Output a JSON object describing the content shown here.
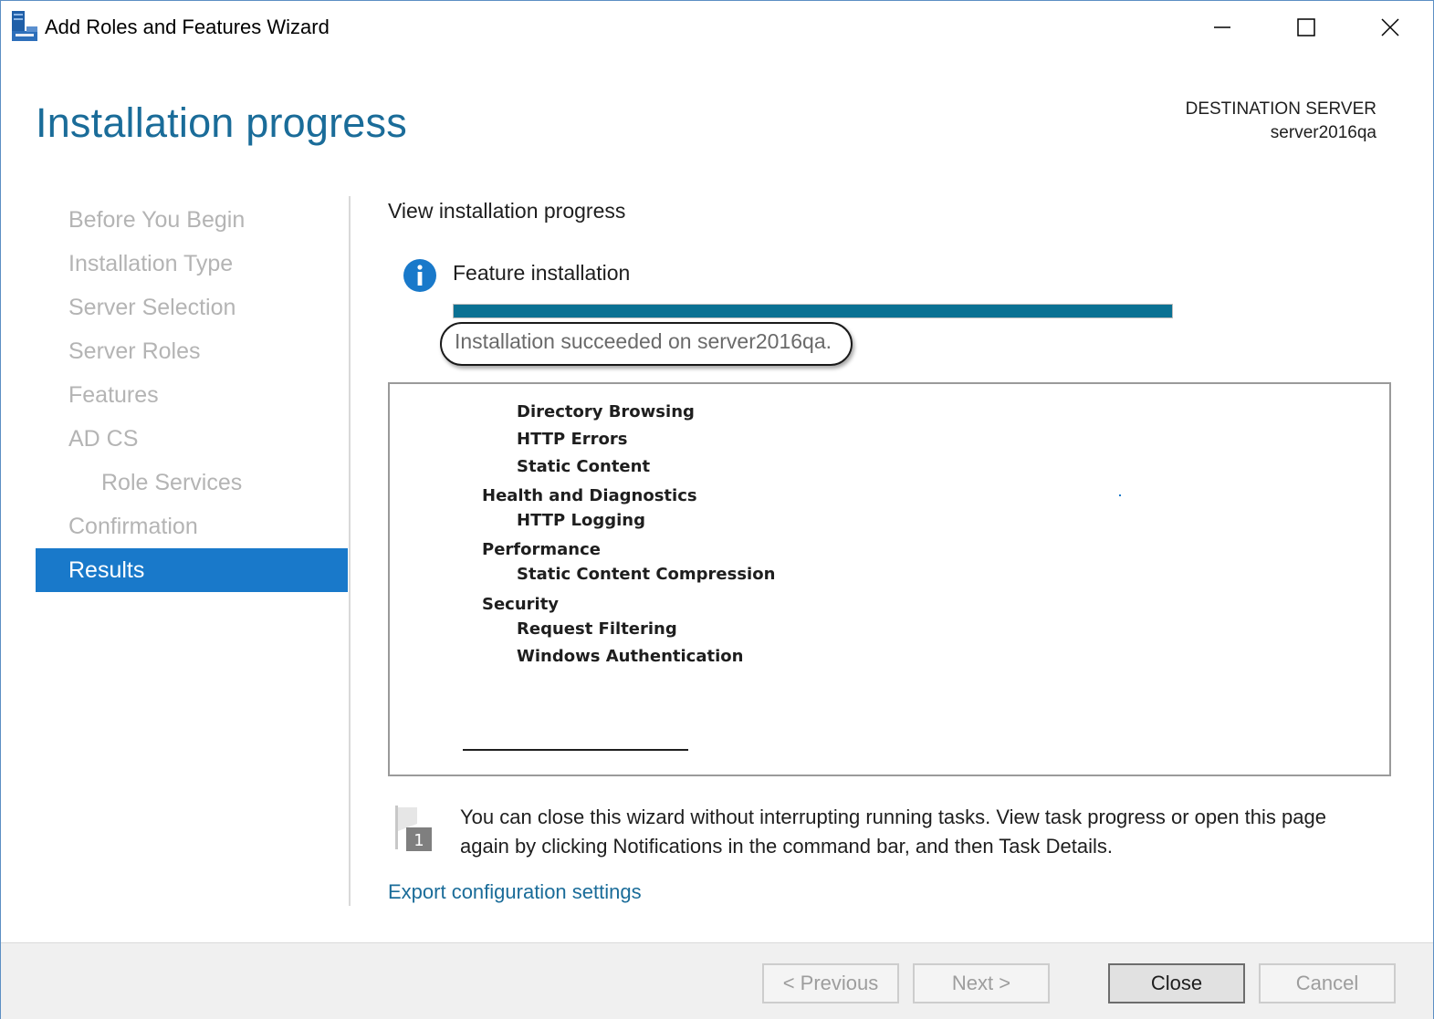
{
  "window": {
    "title": "Add Roles and Features Wizard"
  },
  "header": {
    "page_title": "Installation progress",
    "destination_label": "DESTINATION SERVER",
    "destination_server": "server2016qa"
  },
  "nav": {
    "items": [
      {
        "label": "Before You Begin"
      },
      {
        "label": "Installation Type"
      },
      {
        "label": "Server Selection"
      },
      {
        "label": "Server Roles"
      },
      {
        "label": "Features"
      },
      {
        "label": "AD CS"
      },
      {
        "label": "Role Services"
      },
      {
        "label": "Confirmation"
      },
      {
        "label": "Results"
      }
    ],
    "active": "Results"
  },
  "content": {
    "section_heading": "View installation progress",
    "feature_title": "Feature installation",
    "progress_fraction": 1.0,
    "status_text": "Installation succeeded on server2016qa.",
    "tree": [
      {
        "label": "Directory Browsing",
        "level": 2
      },
      {
        "label": "HTTP Errors",
        "level": 2
      },
      {
        "label": "Static Content",
        "level": 2
      },
      {
        "label": "Health and Diagnostics",
        "level": 1
      },
      {
        "label": "HTTP Logging",
        "level": 2
      },
      {
        "label": "Performance",
        "level": 1
      },
      {
        "label": "Static Content Compression",
        "level": 2
      },
      {
        "label": "Security",
        "level": 1
      },
      {
        "label": "Request Filtering",
        "level": 2
      },
      {
        "label": "Windows Authentication",
        "level": 2
      }
    ],
    "note_text": "You can close this wizard without interrupting running tasks. View task progress or open this page again by clicking Notifications in the command bar, and then Task Details.",
    "flag_badge": "1",
    "export_link": "Export configuration settings"
  },
  "footer": {
    "previous_label": "< Previous",
    "next_label": "Next >",
    "close_label": "Close",
    "cancel_label": "Cancel"
  },
  "colors": {
    "accent": "#1979ca",
    "title_blue": "#1a6c99",
    "progress": "#0a7193",
    "nav_inactive": "#b4b4b4"
  }
}
